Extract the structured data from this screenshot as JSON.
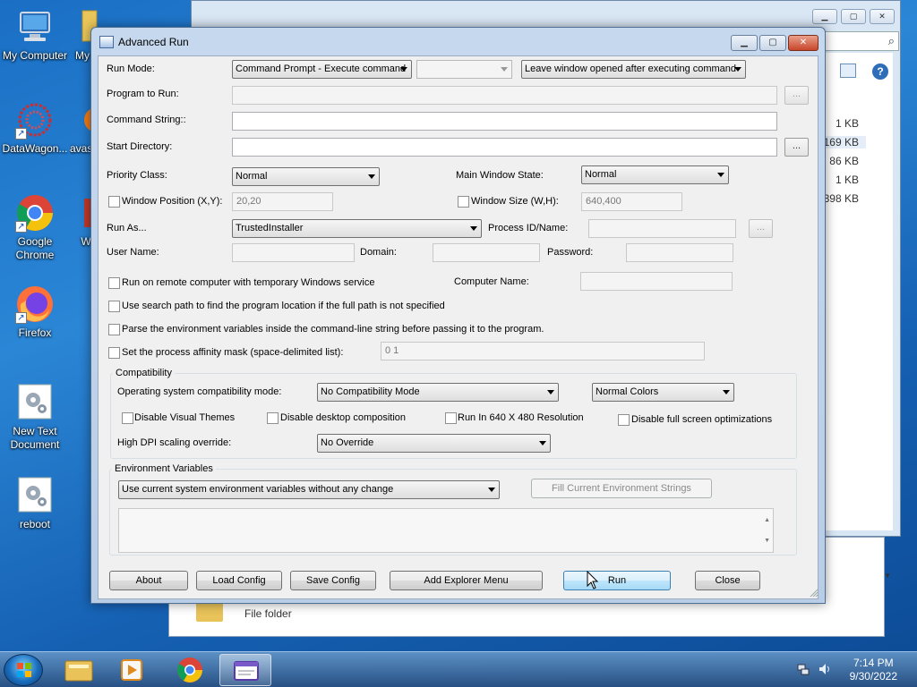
{
  "desktop": {
    "icons": [
      {
        "label": "My Computer"
      },
      {
        "label": "My"
      },
      {
        "label": "DataWagon..."
      },
      {
        "label": "avas"
      },
      {
        "label": "Google Chrome"
      },
      {
        "label": "W"
      },
      {
        "label": "Firefox"
      },
      {
        "label": "New Text Document"
      },
      {
        "label": "reboot"
      }
    ]
  },
  "background_window": {
    "sizes": [
      "1 KB",
      "169 KB",
      "86 KB",
      "1 KB",
      "8,398 KB"
    ],
    "lower_item": "File folder"
  },
  "dialog": {
    "title": "Advanced Run",
    "run_mode_label": "Run Mode:",
    "run_mode_value": "Command Prompt - Execute command",
    "window_option_value": "Leave window opened after executing command",
    "program_label": "Program to Run:",
    "program_browse": "...",
    "command_string_label": "Command String::",
    "start_dir_label": "Start Directory:",
    "start_dir_browse": "...",
    "priority_label": "Priority Class:",
    "priority_value": "Normal",
    "main_window_state_label": "Main Window State:",
    "main_window_state_value": "Normal",
    "window_position_label": "Window Position (X,Y):",
    "window_position_value": "20,20",
    "window_size_label": "Window Size (W,H):",
    "window_size_value": "640,400",
    "run_as_label": "Run As...",
    "run_as_value": "TrustedInstaller",
    "process_id_label": "Process ID/Name:",
    "process_browse": "...",
    "user_name_label": "User Name:",
    "domain_label": "Domain:",
    "password_label": "Password:",
    "remote_label": "Run on remote computer with temporary Windows service",
    "computer_name_label": "Computer Name:",
    "search_path_label": "Use search path to find the program location if the full path is not specified",
    "parse_env_label": "Parse the environment variables inside the command-line string before passing it to the program.",
    "affinity_label": "Set the process affinity mask (space-delimited list):",
    "affinity_value": "0 1",
    "compat_group": "Compatibility",
    "os_compat_label": "Operating system compatibility mode:",
    "os_compat_value": "No Compatibility Mode",
    "colors_value": "Normal Colors",
    "disable_themes_label": "Disable Visual Themes",
    "disable_composition_label": "Disable desktop composition",
    "run_640_label": "Run In 640 X 480 Resolution",
    "disable_fullscreen_label": "Disable full screen optimizations",
    "dpi_label": "High DPI scaling override:",
    "dpi_value": "No Override",
    "env_group": "Environment Variables",
    "env_value": "Use current system environment variables without any change",
    "fill_env_button": "Fill Current Environment Strings",
    "buttons": {
      "about": "About",
      "load": "Load Config",
      "save": "Save Config",
      "add_menu": "Add Explorer Menu",
      "run": "Run",
      "close": "Close"
    }
  },
  "taskbar": {
    "time": "7:14 PM",
    "date": "9/30/2022"
  }
}
